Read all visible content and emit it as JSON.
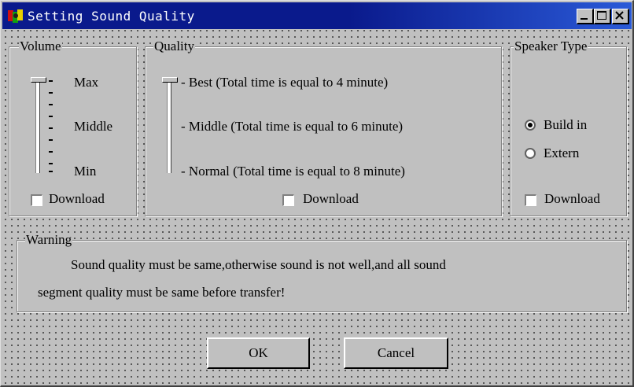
{
  "window": {
    "title": "Setting Sound Quality"
  },
  "volume": {
    "legend": "Volume",
    "labels": {
      "max": "Max",
      "middle": "Middle",
      "min": "Min"
    },
    "download_label": "Download",
    "download_checked": false
  },
  "quality": {
    "legend": "Quality",
    "options": [
      "- Best (Total time is equal to 4 minute)",
      "- Middle (Total time is equal to 6 minute)",
      "- Normal (Total time is equal to 8 minute)"
    ],
    "download_label": "Download",
    "download_checked": false
  },
  "speaker": {
    "legend": "Speaker Type",
    "options": [
      "Build in",
      "Extern"
    ],
    "selected": "Build in",
    "download_label": "Download",
    "download_checked": false
  },
  "warning": {
    "legend": "Warning",
    "line1": "Sound quality must be  same,otherwise  sound  is not well,and all sound",
    "line2": "segment quality must be same before transfer!"
  },
  "buttons": {
    "ok": "OK",
    "cancel": "Cancel"
  },
  "icons": {
    "app": "app-icon",
    "minimize": "minimize-icon",
    "maximize": "maximize-icon",
    "close": "close-icon"
  }
}
